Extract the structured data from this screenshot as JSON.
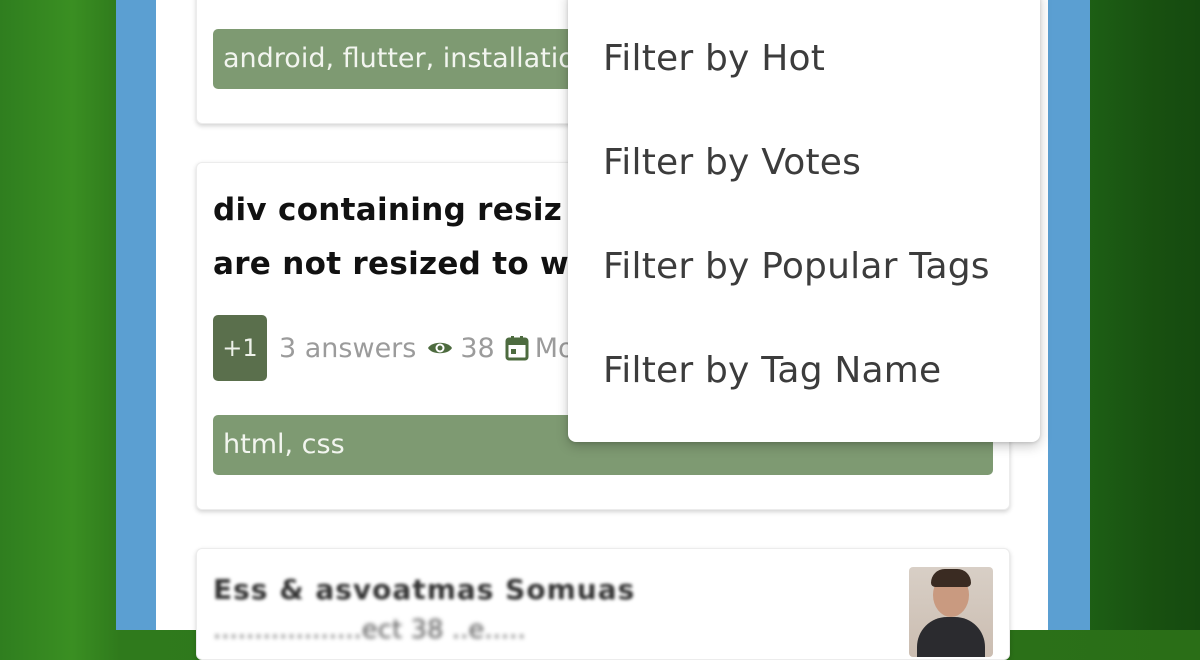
{
  "menu": {
    "items": [
      {
        "label": "Filter by Hot"
      },
      {
        "label": "Filter by Votes"
      },
      {
        "label": "Filter by Popular Tags"
      },
      {
        "label": "Filter by Tag Name"
      }
    ]
  },
  "questions": [
    {
      "tags": "android, flutter, installatio"
    },
    {
      "title_line1": "div containing resiz",
      "title_line2": "are not resized to wi",
      "votes": "+1",
      "answers": "3 answers",
      "views": "38",
      "date_partial": "Mo",
      "tags": "html, css",
      "icons": {
        "views": "eye-icon",
        "date": "calendar-icon"
      }
    },
    {
      "title_blurred": "Ess & asvoatmas Somuas",
      "subtitle_blurred": "..................ect 38 ..e....."
    }
  ],
  "colors": {
    "tag_bg": "#7e9a72",
    "vote_bg": "#5a6f4c",
    "icon_green": "#4d6b3f",
    "frame_blue": "#5b9fd2"
  }
}
